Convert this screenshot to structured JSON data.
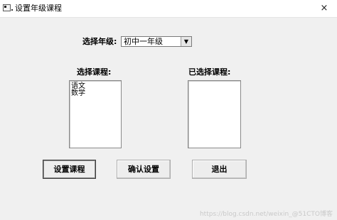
{
  "window": {
    "title": "设置年级课程",
    "close_glyph": "×"
  },
  "grade": {
    "label": "选择年级:",
    "selected": "初中一年级"
  },
  "courses": {
    "label": "选择课程:",
    "items": [
      "语文",
      "数学"
    ]
  },
  "selected_courses": {
    "label": "已选择课程:",
    "items": []
  },
  "buttons": {
    "set": "设置课程",
    "confirm": "确认设置",
    "exit": "退出"
  },
  "watermark": "https://blog.csdn.net/weixin_@51CTO博客"
}
